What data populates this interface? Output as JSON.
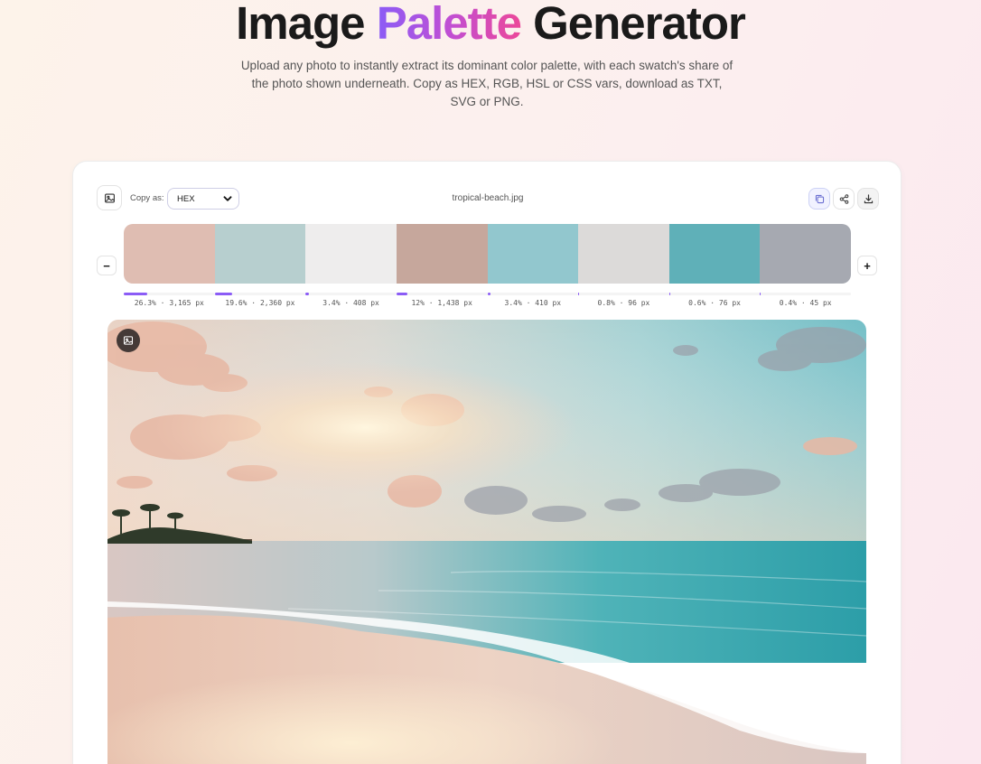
{
  "header": {
    "title_start": "Image ",
    "title_accent": "Palette",
    "title_end": " Generator",
    "subtitle": "Upload any photo to instantly extract its dominant color palette, with each swatch's share of the photo shown underneath. Copy as HEX, RGB, HSL or CSS vars, download as TXT, SVG or PNG."
  },
  "toolbar": {
    "upload_icon": "image-icon",
    "copy_as_label": "Copy as:",
    "format_selected": "HEX",
    "filename": "tropical-beach.jpg",
    "actions": [
      "copy-icon",
      "share-icon",
      "download-icon"
    ]
  },
  "palette": {
    "decrease_label": "−",
    "increase_label": "+",
    "swatches": [
      {
        "color": "#dfbdb2",
        "percent": 26.3,
        "label": "26.3% · 3,165 px"
      },
      {
        "color": "#b7cfcf",
        "percent": 19.6,
        "label": "19.6% · 2,360 px"
      },
      {
        "color": "#eeeded",
        "percent": 3.4,
        "label": "3.4% · 408 px"
      },
      {
        "color": "#c6a79c",
        "percent": 12,
        "label": "12% · 1,438 px"
      },
      {
        "color": "#92c7ce",
        "percent": 3.4,
        "label": "3.4% · 410 px"
      },
      {
        "color": "#dcdad9",
        "percent": 0.8,
        "label": "0.8% · 96 px"
      },
      {
        "color": "#5fb0b8",
        "percent": 0.6,
        "label": "0.6% · 76 px"
      },
      {
        "color": "#a6a9b1",
        "percent": 0.4,
        "label": "0.4% · 45 px"
      }
    ]
  },
  "preview": {
    "badge_icon": "image-icon"
  },
  "colors": {
    "accent": "#8b5cf6",
    "accent_pink": "#ec4899"
  }
}
